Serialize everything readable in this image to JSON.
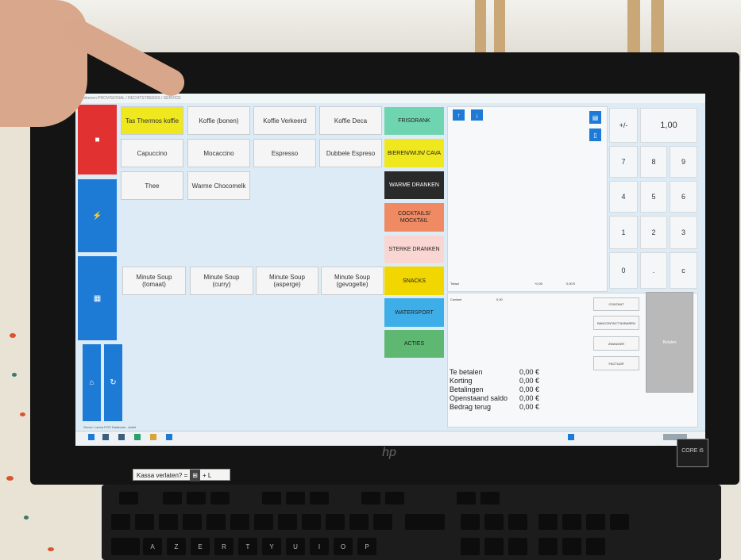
{
  "sticker": {
    "text": "Kassa verlaten? =",
    "key1": "⊞",
    "key2": "+ L"
  },
  "brand": {
    "monitor": "hp",
    "cpu_badge": "CORE i5"
  },
  "screen": {
    "title": "Afrekenen PROVISIONAL / RECHTSTREEKS / SERVICE",
    "side_buttons": [
      {
        "icon": "■",
        "color": "#e23131"
      },
      {
        "icon": "⚡",
        "color": "#1d7bd6"
      },
      {
        "icon": "▦",
        "color": "#1d7bd6"
      },
      {
        "icon": "⌂",
        "color": "#1d7bd6"
      },
      {
        "icon": "↻",
        "color": "#1d7bd6"
      }
    ],
    "products": [
      {
        "label": "Tas Thermos koffie",
        "color": "#f0e81e"
      },
      {
        "label": "Koffie (bonen)"
      },
      {
        "label": "Koffie Verkeerd"
      },
      {
        "label": "Koffie Deca"
      },
      {
        "label": "Capuccino"
      },
      {
        "label": "Mocaccino"
      },
      {
        "label": "Espresso"
      },
      {
        "label": "Dubbele Espreso"
      },
      {
        "label": "Thee"
      },
      {
        "label": "Warme Chocomelk"
      }
    ],
    "soups": [
      {
        "line1": "Minute Soup",
        "line2": "(tomaat)"
      },
      {
        "line1": "Minute Soup",
        "line2": "(curry)"
      },
      {
        "line1": "Minute Soup",
        "line2": "(asperge)"
      },
      {
        "line1": "Minute Soup",
        "line2": "(gevogelte)"
      }
    ],
    "categories": [
      {
        "label": "FRISDRANK",
        "color": "#6fd4b0"
      },
      {
        "label": "BIEREN/WIJN/ CAVA",
        "color": "#f0e81e"
      },
      {
        "label": "WARME DRANKEN",
        "color": "#2a2a2a",
        "text_color": "#ffffff"
      },
      {
        "label": "COCKTAILS/ MOCKTAIL",
        "color": "#f08a62"
      },
      {
        "label": "STERKE DRANKEN",
        "color": "#f9d6d2"
      },
      {
        "label": "SNACKS",
        "color": "#f2d600"
      },
      {
        "label": "WATERSPORT",
        "color": "#3eaee8"
      },
      {
        "label": "ACTIES",
        "color": "#5fb872"
      }
    ],
    "order": {
      "up_icon": "↑",
      "down_icon": "↓",
      "total_label": "Totaal",
      "total_value": "+0,00",
      "total_value2": "0,00 €",
      "klant_label": "Contant",
      "klant_value": "0,00"
    },
    "keypad": {
      "toggle": "+/-",
      "display": "1,00",
      "keys": [
        "7",
        "8",
        "9",
        "4",
        "5",
        "6",
        "1",
        "2",
        "3",
        "0",
        ".",
        "c"
      ]
    },
    "totals": [
      {
        "label": "Te betalen",
        "value": "0,00 €"
      },
      {
        "label": "Korting",
        "value": "0,00 €"
      },
      {
        "label": "Betalingen",
        "value": "0,00 €"
      },
      {
        "label": "Openstaand saldo",
        "value": "0,00 €"
      },
      {
        "label": "Bedrag terug",
        "value": "0,00 €"
      }
    ],
    "payment_buttons": [
      "CONTANT",
      "BANCONTACT BIJBAREN",
      "ZWANGER",
      "FACTUUR"
    ],
    "confirm_label": "Betalen",
    "status_bar": "Server: Lanna POS Databank - Actief"
  },
  "keyboard_row1": [
    "A",
    "Z",
    "E",
    "R",
    "T",
    "Y",
    "U",
    "I",
    "O",
    "P"
  ]
}
